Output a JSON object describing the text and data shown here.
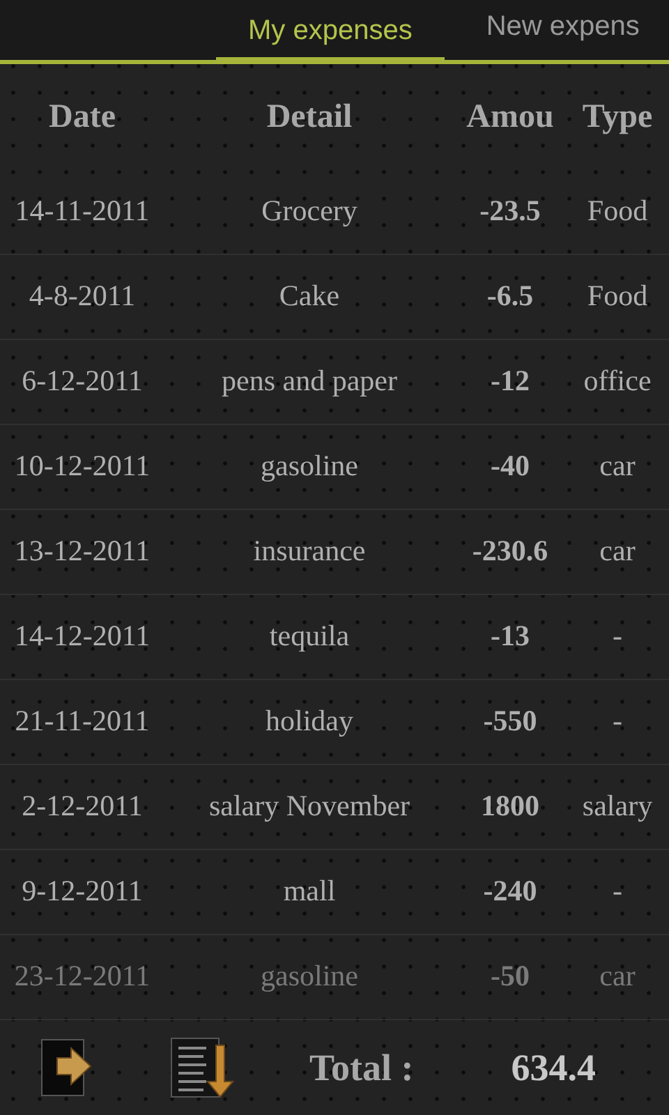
{
  "tabs": [
    {
      "label": "My expenses",
      "selected": true
    },
    {
      "label": "New expens",
      "selected": false
    }
  ],
  "table": {
    "columns": [
      "Date",
      "Detail",
      "Amou",
      "Type"
    ],
    "rows": [
      [
        "14-11-2011",
        "Grocery",
        "-23.5",
        "Food"
      ],
      [
        "4-8-2011",
        "Cake",
        "-6.5",
        "Food"
      ],
      [
        "6-12-2011",
        "pens and paper",
        "-12",
        "office"
      ],
      [
        "10-12-2011",
        "gasoline",
        "-40",
        "car"
      ],
      [
        "13-12-2011",
        "insurance",
        "-230.6",
        "car"
      ],
      [
        "14-12-2011",
        "tequila",
        "-13",
        "-"
      ],
      [
        "21-11-2011",
        "holiday",
        "-550",
        "-"
      ],
      [
        "2-12-2011",
        "salary November",
        "1800",
        "salary"
      ],
      [
        "9-12-2011",
        "mall",
        "-240",
        "-"
      ],
      [
        "23-12-2011",
        "gasoline",
        "-50",
        "car"
      ]
    ]
  },
  "footer": {
    "total_label": "Total :",
    "total_value": "634.4"
  }
}
